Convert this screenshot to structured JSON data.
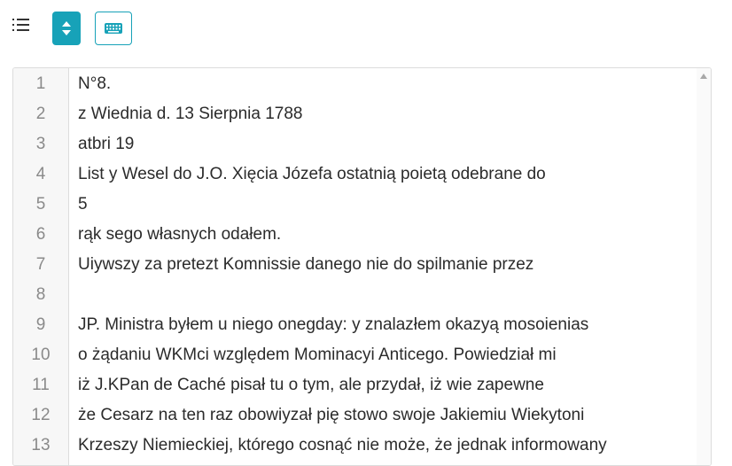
{
  "toolbar": {
    "list_icon": "list-numbered-icon",
    "sort_icon": "sort-up-down-icon",
    "keyboard_icon": "keyboard-icon",
    "accent_color": "#17a2b8"
  },
  "editor": {
    "lines": [
      {
        "number": "1",
        "text": "N°8."
      },
      {
        "number": "2",
        "text": "z Wiednia d. 13 Sierpnia 1788"
      },
      {
        "number": "3",
        "text": "atbri 19"
      },
      {
        "number": "4",
        "text": "List y Wesel do J.O. Xięcia Józefa ostatnią poietą odebrane do"
      },
      {
        "number": "5",
        "text": "5"
      },
      {
        "number": "6",
        "text": "rąk sego własnych odałem."
      },
      {
        "number": "7",
        "text": "Uiywszy za pretezt Komnissie danego nie do spilmanie przez"
      },
      {
        "number": "8",
        "text": ""
      },
      {
        "number": "9",
        "text": "JP. Ministra byłem u niego onegday: y znalazłem okazyą mosoienias"
      },
      {
        "number": "10",
        "text": "o żądaniu WKMci względem Mominacyi Anticego. Powiedział mi"
      },
      {
        "number": "11",
        "text": "iż J.KPan de Caché pisał tu o tym, ale przydał, iż wie zapewne"
      },
      {
        "number": "12",
        "text": "że Cesarz na ten raz obowiyzał pię stowo swoje Jakiemiu Wiekytoni"
      },
      {
        "number": "13",
        "text": "Krzeszy Niemieckiej, którego cosnąć nie może, że jednak informowany"
      }
    ]
  }
}
